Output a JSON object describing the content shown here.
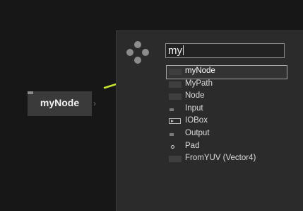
{
  "canvas_node": {
    "label": "myNode"
  },
  "search": {
    "value": "my"
  },
  "results": [
    {
      "label": "myNode",
      "icon": "node-icon",
      "selected": true
    },
    {
      "label": "MyPath",
      "icon": "node-icon",
      "selected": false
    },
    {
      "label": "Node",
      "icon": "node-icon",
      "selected": false
    },
    {
      "label": "Input",
      "icon": "input-icon",
      "selected": false
    },
    {
      "label": "IOBox",
      "icon": "iobox-icon",
      "selected": false
    },
    {
      "label": "Output",
      "icon": "output-icon",
      "selected": false
    },
    {
      "label": "Pad",
      "icon": "pad-icon",
      "selected": false
    },
    {
      "label": "FromYUV (Vector4)",
      "icon": "node-icon",
      "selected": false
    }
  ],
  "colors": {
    "annotation_arrow": "#c8e630",
    "panel_bg": "#2b2b2b",
    "canvas_bg": "#171717"
  }
}
